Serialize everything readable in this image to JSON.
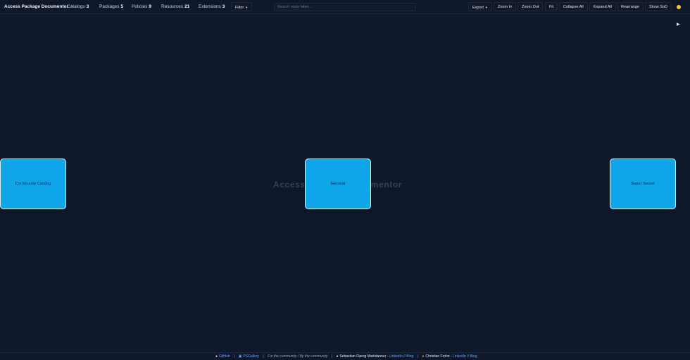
{
  "header": {
    "title": "Access Package Documentor",
    "stats": [
      {
        "label": "Catalogs",
        "count": "3"
      },
      {
        "label": "Packages",
        "count": "5"
      },
      {
        "label": "Policies",
        "count": "9"
      },
      {
        "label": "Resources",
        "count": "21"
      },
      {
        "label": "Extensions",
        "count": "3"
      }
    ],
    "filter_label": "Filter",
    "search_placeholder": "Search node label...",
    "buttons": {
      "export": "Export",
      "zoom_in": "Zoom In",
      "zoom_out": "Zoom Out",
      "fit": "Fit",
      "collapse_all": "Collapse All",
      "expand_all": "Expand All",
      "rearrange": "Rearrange",
      "show_sod": "Show SoD"
    },
    "status_color": "#facc15"
  },
  "panel_toggle": "▶",
  "canvas": {
    "watermark": "Access Package Documentor",
    "nodes": [
      {
        "label": "Community Catalog"
      },
      {
        "label": "General"
      },
      {
        "label": "Super Secret"
      }
    ],
    "node_color": "#0ea5e9"
  },
  "footer": {
    "github": "GitHub",
    "psgallery": "PSGallery",
    "tagline": "For the community / By the community",
    "author1": "Sebastian Flæng Markdanner",
    "author2": "Christian Frohn",
    "linkedin": "LinkedIn",
    "blog": "Blog",
    "dash": "-",
    "slashes": "//",
    "pipe": "|"
  }
}
